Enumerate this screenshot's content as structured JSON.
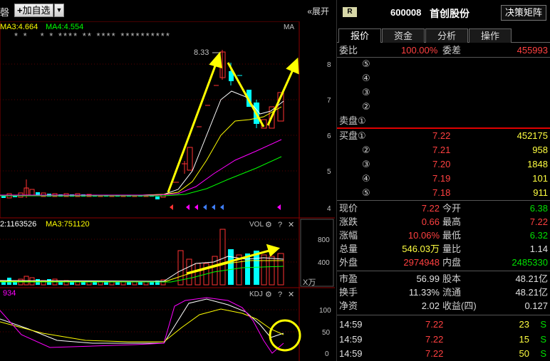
{
  "toolbar": {
    "cut_label": "磬",
    "add_watch": "加自选",
    "expand": "«展开"
  },
  "chart": {
    "ma_labels": {
      "ma3": "MA3:4.664",
      "ma4": "MA4:4.554",
      "ma": "MA"
    },
    "stars": "* *   * * **** ** **** **********",
    "high_marker": "8.33",
    "price_axis": [
      "8",
      "7",
      "6",
      "5",
      "4"
    ],
    "vol_labels": {
      "ma2": "2:1163526",
      "ma3": "MA3:751120",
      "title": "VOL"
    },
    "vol_axis": [
      "800",
      "400"
    ],
    "vol_unit": "X万",
    "kdj_labels": {
      "value": "934",
      "title": "KDJ"
    },
    "kdj_axis": [
      "100",
      "50",
      "0"
    ]
  },
  "panel": {
    "badge": "R",
    "code": "600008",
    "name": "首创股份",
    "decision": "决策矩阵",
    "tabs": [
      "报价",
      "资金",
      "分析",
      "操作"
    ],
    "weibi": {
      "label": "委比",
      "value": "100.00%",
      "label2": "委差",
      "value2": "455993"
    },
    "sell": [
      {
        "label": "⑤"
      },
      {
        "label": "④"
      },
      {
        "label": "③"
      },
      {
        "label": "②"
      },
      {
        "label": "卖盘①"
      }
    ],
    "buy": [
      {
        "label": "买盘①",
        "price": "7.22",
        "vol": "452175"
      },
      {
        "label": "②",
        "price": "7.21",
        "vol": "958"
      },
      {
        "label": "③",
        "price": "7.20",
        "vol": "1848"
      },
      {
        "label": "④",
        "price": "7.19",
        "vol": "101"
      },
      {
        "label": "⑤",
        "price": "7.18",
        "vol": "911"
      }
    ],
    "quote": [
      {
        "l1": "现价",
        "v1": "7.22",
        "c1": "red",
        "l2": "今开",
        "v2": "6.38",
        "c2": "green"
      },
      {
        "l1": "涨跌",
        "v1": "0.66",
        "c1": "red",
        "l2": "最高",
        "v2": "7.22",
        "c2": "red"
      },
      {
        "l1": "涨幅",
        "v1": "10.06%",
        "c1": "red",
        "l2": "最低",
        "v2": "6.32",
        "c2": "green"
      },
      {
        "l1": "总量",
        "v1": "546.03万",
        "c1": "yellow",
        "l2": "量比",
        "v2": "1.14",
        "c2": "white"
      },
      {
        "l1": "外盘",
        "v1": "2974948",
        "c1": "red",
        "l2": "内盘",
        "v2": "2485330",
        "c2": "green"
      }
    ],
    "fund": [
      {
        "l1": "市盈",
        "v1": "56.99",
        "l2": "股本",
        "v2": "48.21亿"
      },
      {
        "l1": "换手",
        "v1": "11.33%",
        "l2": "流通",
        "v2": "48.21亿"
      },
      {
        "l1": "净资",
        "v1": "2.02",
        "l2": "收益(四)",
        "v2": "0.127"
      }
    ],
    "ticks": [
      {
        "time": "14:59",
        "price": "7.22",
        "vol": "23",
        "side": "S"
      },
      {
        "time": "14:59",
        "price": "7.22",
        "vol": "15",
        "side": "S"
      },
      {
        "time": "14:59",
        "price": "7.22",
        "vol": "50",
        "side": "S"
      }
    ]
  },
  "colors": {
    "up": "#ff3232",
    "down": "#00ffff",
    "ma_white": "#ffffff",
    "ma_yellow": "#ffff00",
    "ma_magenta": "#ff00ff",
    "ma_green": "#00ff00",
    "arrow": "#ffff00"
  }
}
